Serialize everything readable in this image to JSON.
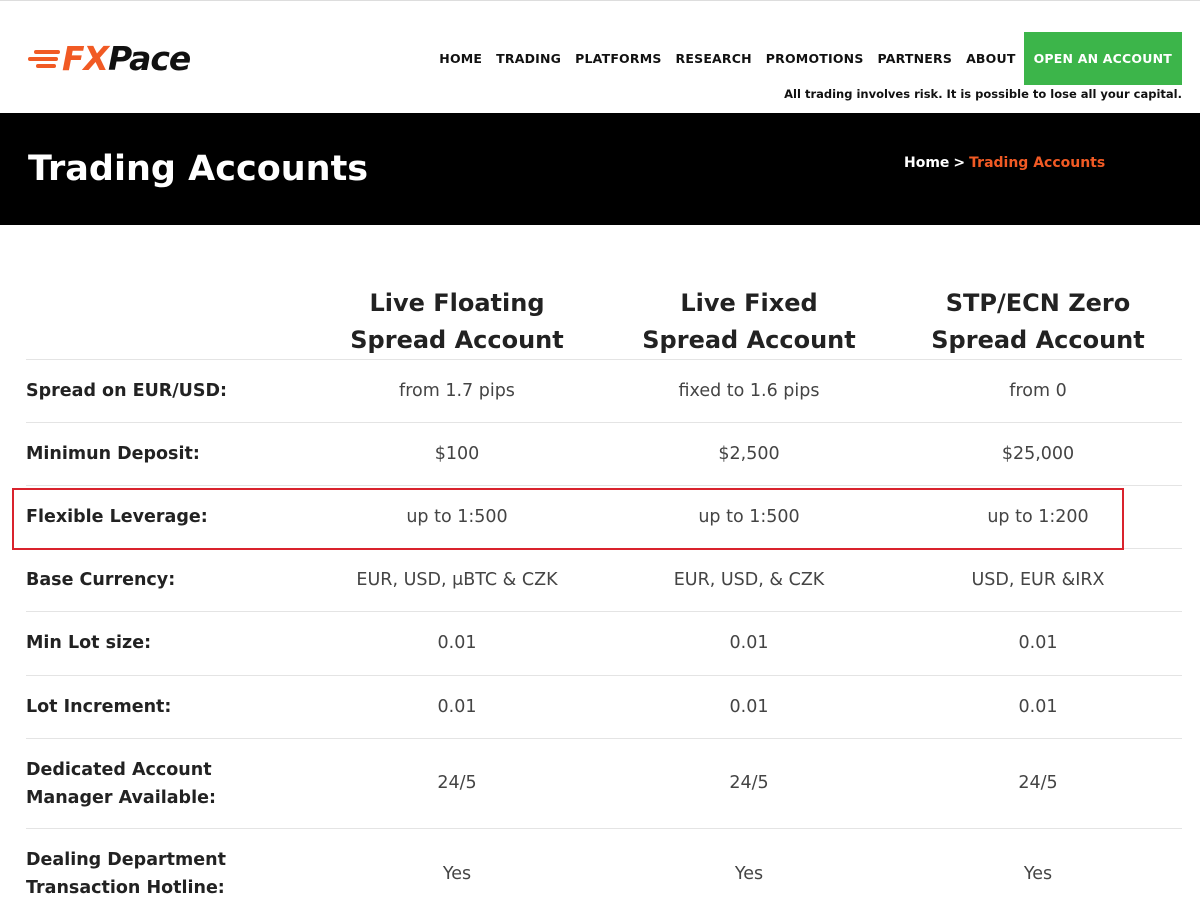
{
  "logo": {
    "text_fx": "FX",
    "text_pace": "Pace",
    "accent": "#f15a24"
  },
  "nav": {
    "items": [
      "HOME",
      "TRADING",
      "PLATFORMS",
      "RESEARCH",
      "PROMOTIONS",
      "PARTNERS",
      "ABOUT"
    ],
    "cta": "OPEN AN ACCOUNT",
    "cta_color": "#3cb54a"
  },
  "risk_notice": "All trading involves risk. It is possible to lose all your capital.",
  "banner": {
    "title": "Trading Accounts",
    "breadcrumb_home": "Home",
    "breadcrumb_sep": ">",
    "breadcrumb_current": "Trading Accounts"
  },
  "table": {
    "columns": [
      {
        "line1": "Live Floating",
        "line2": "Spread Account"
      },
      {
        "line1": "Live Fixed",
        "line2": "Spread Account"
      },
      {
        "line1": "STP/ECN Zero",
        "line2": "Spread Account"
      }
    ],
    "rows": [
      {
        "label1": "Spread on EUR/USD:",
        "label2": "",
        "values": [
          "from 1.7 pips",
          "fixed to 1.6 pips",
          "from 0"
        ]
      },
      {
        "label1": "Minimun Deposit:",
        "label2": "",
        "values": [
          "$100",
          "$2,500",
          "$25,000"
        ]
      },
      {
        "label1": "Flexible Leverage:",
        "label2": "",
        "values": [
          "up to 1:500",
          "up to 1:500",
          "up to 1:200"
        ]
      },
      {
        "label1": "Base Currency:",
        "label2": "",
        "values": [
          "EUR, USD, μBTC & CZK",
          "EUR, USD, & CZK",
          "USD, EUR &IRX"
        ]
      },
      {
        "label1": "Min Lot size:",
        "label2": "",
        "values": [
          "0.01",
          "0.01",
          "0.01"
        ]
      },
      {
        "label1": "Lot Increment:",
        "label2": "",
        "values": [
          "0.01",
          "0.01",
          "0.01"
        ]
      },
      {
        "label1": "Dedicated Account",
        "label2": "Manager Available:",
        "values": [
          "24/5",
          "24/5",
          "24/5"
        ]
      },
      {
        "label1": "Dealing Department",
        "label2": "Transaction Hotline:",
        "values": [
          "Yes",
          "Yes",
          "Yes"
        ]
      }
    ],
    "highlight_color": "#d9232d"
  }
}
